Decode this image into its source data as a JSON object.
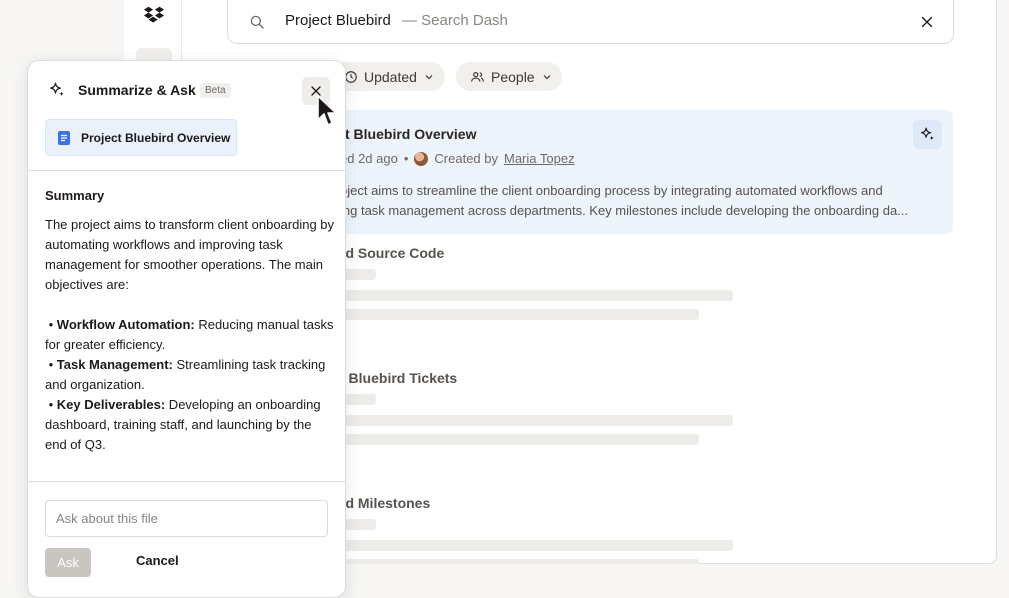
{
  "search": {
    "query": "Project Bluebird",
    "hint": "— Search Dash"
  },
  "filters": [
    {
      "label": "Updated"
    },
    {
      "label": "People"
    }
  ],
  "results": {
    "featured": {
      "title": "t Bluebird Overview",
      "meta_updated": "ed 2d ago",
      "meta_created": "Created by",
      "author": "Maria Topez",
      "desc_line1": "oject aims to streamline the client onboarding process by integrating automated workflows and",
      "desc_line2": "ing task management across departments. Key milestones include developing the onboarding da..."
    },
    "items": [
      {
        "title": "rd Source Code"
      },
      {
        "title": "t Bluebird Tickets"
      },
      {
        "title": "rd Milestones"
      }
    ]
  },
  "panel": {
    "title": "Summarize & Ask",
    "badge": "Beta",
    "file_name": "Project Bluebird Overview",
    "summary_heading": "Summary",
    "intro": "The project aims to transform client onboarding by automating workflows and improving task management for smoother operations. The main objectives are:",
    "bullets": [
      {
        "term": "Workflow Automation:",
        "text": " Reducing manual tasks for greater efficiency."
      },
      {
        "term": "Task Management:",
        "text": " Streamlining task tracking and organization."
      },
      {
        "term": "Key Deliverables:",
        "text": " Developing an onboarding dashboard, training staff, and launching by the end of Q3."
      }
    ],
    "input_placeholder": "Ask about this file",
    "ask_label": "Ask",
    "cancel_label": "Cancel"
  },
  "colors": {
    "accent": "#0061fe",
    "card_bg": "#eef4fc"
  }
}
